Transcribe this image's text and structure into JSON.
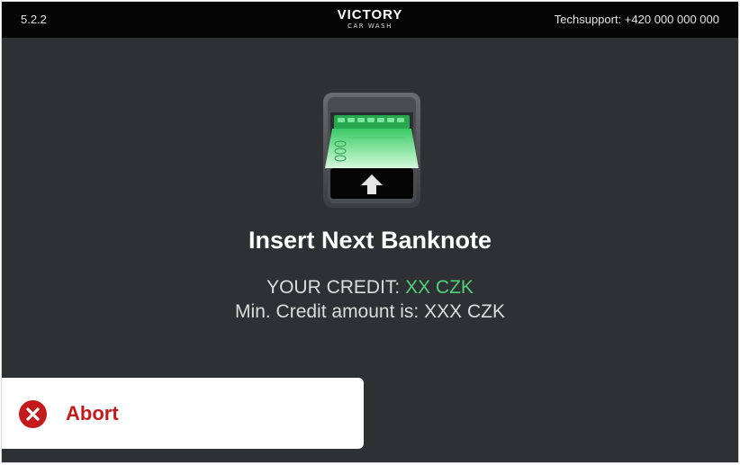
{
  "header": {
    "version": "5.2.2",
    "brand_name": "VICTORY",
    "brand_sub": "CAR WASH",
    "support": "Techsupport: +420 000 000 000"
  },
  "main": {
    "icon": "banknote-insert-icon",
    "heading": "Insert Next Banknote",
    "credit_label": "YOUR CREDIT: ",
    "credit_value": "XX CZK",
    "min_credit": "Min. Credit amount is: XXX CZK"
  },
  "actions": {
    "abort_label": "Abort",
    "abort_icon": "close-circle-icon"
  },
  "colors": {
    "background": "#2f3033",
    "topbar": "#050505",
    "credit_accent": "#4fd07a",
    "abort_red": "#c41a1c"
  }
}
